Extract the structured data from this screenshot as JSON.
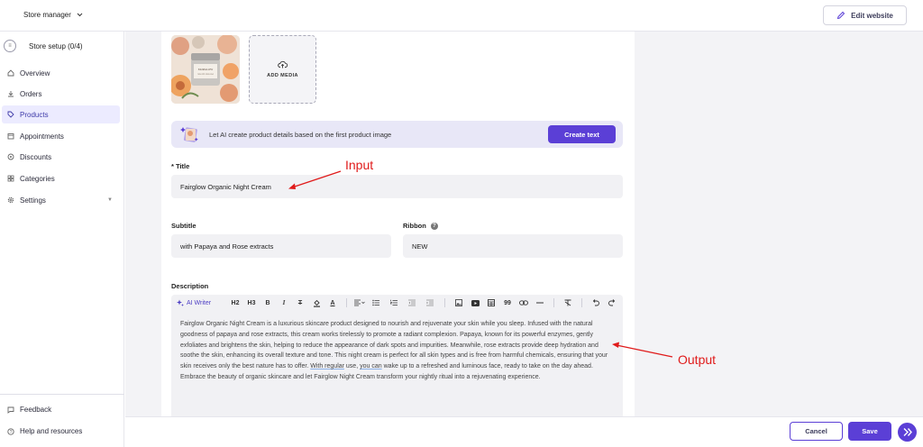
{
  "header": {
    "store_manager": "Store manager",
    "edit_website": "Edit website"
  },
  "sidebar": {
    "setup": "Store setup (0/4)",
    "items": [
      {
        "label": "Overview",
        "icon": "home-icon"
      },
      {
        "label": "Orders",
        "icon": "download-icon"
      },
      {
        "label": "Products",
        "icon": "tag-icon",
        "active": true
      },
      {
        "label": "Appointments",
        "icon": "calendar-icon"
      },
      {
        "label": "Discounts",
        "icon": "discount-icon"
      },
      {
        "label": "Categories",
        "icon": "grid-icon"
      },
      {
        "label": "Settings",
        "icon": "gear-icon"
      }
    ],
    "feedback": "Feedback",
    "help": "Help and resources"
  },
  "media": {
    "add_media": "ADD MEDIA"
  },
  "ai_banner": {
    "text": "Let AI create product details based on the first product image",
    "button": "Create text"
  },
  "form": {
    "title_label": "* Title",
    "title_value": "Fairglow Organic Night Cream",
    "subtitle_label": "Subtitle",
    "subtitle_value": "with Papaya and Rose extracts",
    "ribbon_label": "Ribbon",
    "ribbon_value": "NEW",
    "description_label": "Description"
  },
  "editor": {
    "ai_writer": "AI Writer",
    "h2": "H2",
    "h3": "H3",
    "bold": "B",
    "italic": "I",
    "strike": "T",
    "color": "A",
    "quote": "99",
    "body_before": "Fairglow Organic Night Cream is a luxurious skincare product designed to nourish and rejuvenate your skin while you sleep. Infused with the natural goodness of papaya and rose extracts, this cream works tirelessly to promote a radiant complexion. Papaya, known for its powerful enzymes, gently exfoliates and brightens the skin, helping to reduce the appearance of dark spots and impurities. Meanwhile, rose extracts provide deep hydration and soothe the skin, enhancing its overall texture and tone. This night cream is perfect for all skin types and is free from harmful chemicals, ensuring that your skin receives only the best nature has to offer. ",
    "body_u1": "With regular",
    "body_mid": " use, ",
    "body_u2": "you can",
    "body_after": " wake up to a refreshed and luminous face, ready to take on the day ahead. Embrace the beauty of organic skincare and let Fairglow Night Cream transform your nightly ritual into a rejuvenating experience."
  },
  "annotations": {
    "input": "Input",
    "output": "Output",
    "color": "#e01b1b"
  },
  "footer": {
    "cancel": "Cancel",
    "save": "Save"
  },
  "colors": {
    "accent": "#5b3fd6",
    "active_nav_bg": "#ecebff"
  }
}
